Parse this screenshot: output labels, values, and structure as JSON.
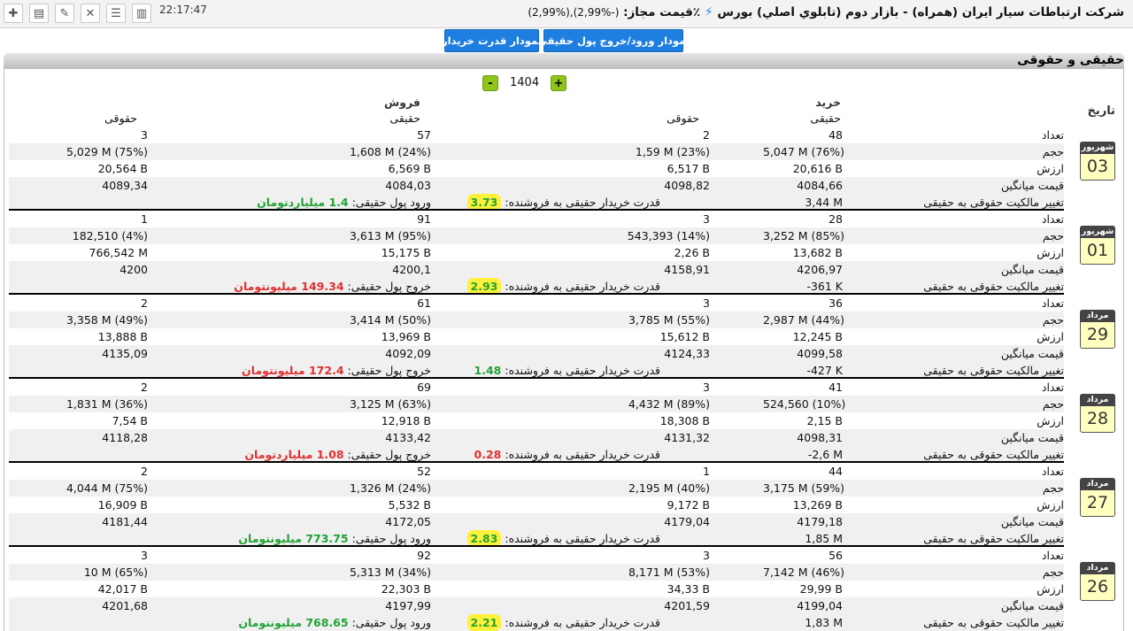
{
  "toolbar": {
    "icons": [
      "plus-icon",
      "document-icon",
      "edit-icon",
      "tools-icon",
      "list-icon",
      "chart-icon"
    ],
    "clock": "22:17:47"
  },
  "header": {
    "company": "شرکت ارتباطات سيار ايران (همراه) - بازار دوم (تابلوي اصلي) بورس",
    "price_label": "٪قيمت مجاز:",
    "price_value": "(2,99%),(2,99%-)"
  },
  "buttons": {
    "flow_chart": "نمودار ورود/خروج پول حقیقی",
    "buyer_power": "نمودار قدرت خريدار"
  },
  "section_title": "حقیقی و حقوقی",
  "year": {
    "value": "1404",
    "inc": "+",
    "dec": "-"
  },
  "col_headers": {
    "date": "تاريخ",
    "buy": "خريد",
    "sell": "فروش",
    "real_buy": "حقيقی",
    "legal_buy": "حقوقی",
    "real_sell": "حقيقی",
    "legal_sell": "حقوقی"
  },
  "row_labels": {
    "count": "تعداد",
    "volume": "حجم",
    "value": "ارزش",
    "avg_price": "قيمت ميانگين",
    "ownership": "تغییر مالکیت حقوقی به حقیقی",
    "buyer_power": "قدرت خريدار حقیقی به فروشنده:"
  },
  "blocks": [
    {
      "month": "شهریور",
      "day": "03",
      "count": [
        "48",
        "2",
        "57",
        "3"
      ],
      "volume": [
        "5,047 M (76%)",
        "1,59 M (23%)",
        "1,608 M (24%)",
        "5,029 M (75%)"
      ],
      "value": [
        "20,616 B",
        "6,517 B",
        "6,569 B",
        "20,564 B"
      ],
      "avg": [
        "4084,66",
        "4098,82",
        "4084,03",
        "4089,34"
      ],
      "ownership": "3,44 M",
      "buyer_power": "3.73",
      "power_color": "green",
      "highlight": true,
      "money_label": "ورود پول حقیقی:",
      "money_value": "1.4 میلیاردتومان",
      "money_color": "green"
    },
    {
      "month": "شهریور",
      "day": "01",
      "count": [
        "28",
        "3",
        "91",
        "1"
      ],
      "volume": [
        "3,252 M (85%)",
        "543,393 (14%)",
        "3,613 M (95%)",
        "182,510 (4%)"
      ],
      "value": [
        "13,682 B",
        "2,26 B",
        "15,175 B",
        "766,542 M"
      ],
      "avg": [
        "4206,97",
        "4158,91",
        "4200,1",
        "4200"
      ],
      "ownership": "-361 K",
      "buyer_power": "2.93",
      "power_color": "green",
      "highlight": true,
      "money_label": "خروج پول حقیقی:",
      "money_value": "149.34 میلیونتومان",
      "money_color": "red"
    },
    {
      "month": "مرداد",
      "day": "29",
      "count": [
        "36",
        "3",
        "61",
        "2"
      ],
      "volume": [
        "2,987 M (44%)",
        "3,785 M (55%)",
        "3,414 M (50%)",
        "3,358 M (49%)"
      ],
      "value": [
        "12,245 B",
        "15,612 B",
        "13,969 B",
        "13,888 B"
      ],
      "avg": [
        "4099,58",
        "4124,33",
        "4092,09",
        "4135,09"
      ],
      "ownership": "-427 K",
      "buyer_power": "1.48",
      "power_color": "green",
      "highlight": false,
      "money_label": "خروج پول حقیقی:",
      "money_value": "172.4 میلیونتومان",
      "money_color": "red"
    },
    {
      "month": "مرداد",
      "day": "28",
      "count": [
        "41",
        "3",
        "69",
        "2"
      ],
      "volume": [
        "524,560 (10%)",
        "4,432 M (89%)",
        "3,125 M (63%)",
        "1,831 M (36%)"
      ],
      "value": [
        "2,15 B",
        "18,308 B",
        "12,918 B",
        "7,54 B"
      ],
      "avg": [
        "4098,31",
        "4131,32",
        "4133,42",
        "4118,28"
      ],
      "ownership": "-2,6 M",
      "buyer_power": "0.28",
      "power_color": "red",
      "highlight": false,
      "money_label": "خروج پول حقیقی:",
      "money_value": "1.08 میلیاردتومان",
      "money_color": "red"
    },
    {
      "month": "مرداد",
      "day": "27",
      "count": [
        "44",
        "1",
        "52",
        "2"
      ],
      "volume": [
        "3,175 M (59%)",
        "2,195 M (40%)",
        "1,326 M (24%)",
        "4,044 M (75%)"
      ],
      "value": [
        "13,269 B",
        "9,172 B",
        "5,532 B",
        "16,909 B"
      ],
      "avg": [
        "4179,18",
        "4179,04",
        "4172,05",
        "4181,44"
      ],
      "ownership": "1,85 M",
      "buyer_power": "2.83",
      "power_color": "green",
      "highlight": true,
      "money_label": "ورود پول حقیقی:",
      "money_value": "773.75 میلیونتومان",
      "money_color": "green"
    },
    {
      "month": "مرداد",
      "day": "26",
      "count": [
        "56",
        "3",
        "92",
        "3"
      ],
      "volume": [
        "7,142 M (46%)",
        "8,171 M (53%)",
        "5,313 M (34%)",
        "10 M (65%)"
      ],
      "value": [
        "29,99 B",
        "34,33 B",
        "22,303 B",
        "42,017 B"
      ],
      "avg": [
        "4199,04",
        "4201,59",
        "4197,99",
        "4201,68"
      ],
      "ownership": "1,83 M",
      "buyer_power": "2.21",
      "power_color": "green",
      "highlight": true,
      "money_label": "ورود پول حقیقی:",
      "money_value": "768.65 میلیونتومان",
      "money_color": "green"
    }
  ]
}
